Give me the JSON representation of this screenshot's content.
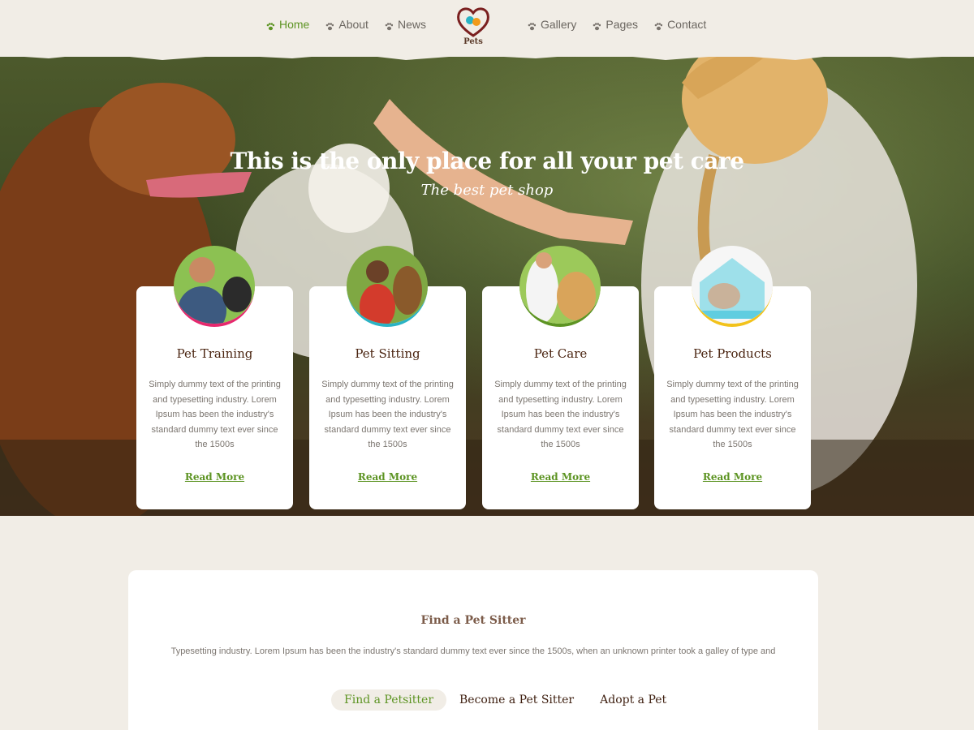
{
  "nav": {
    "left": [
      {
        "label": "Home",
        "active": true
      },
      {
        "label": "About",
        "active": false
      },
      {
        "label": "News",
        "active": false
      }
    ],
    "logo_text": "Pets",
    "right": [
      {
        "label": "Gallery"
      },
      {
        "label": "Pages"
      },
      {
        "label": "Contact"
      }
    ]
  },
  "hero": {
    "title": "This is the only place for all your pet care",
    "subtitle": "The best pet shop"
  },
  "cards": [
    {
      "title": "Pet Training",
      "text": "Simply dummy text of the printing and typesetting industry. Lorem Ipsum has been the industry's standard dummy text ever since the 1500s",
      "link": "Read More",
      "accent": "#e6286e"
    },
    {
      "title": "Pet Sitting",
      "text": "Simply dummy text of the printing and typesetting industry. Lorem Ipsum has been the industry's standard dummy text ever since the 1500s",
      "link": "Read More",
      "accent": "#2ab3c5"
    },
    {
      "title": "Pet Care",
      "text": "Simply dummy text of the printing and typesetting industry. Lorem Ipsum has been the industry's standard dummy text ever since the 1500s",
      "link": "Read More",
      "accent": "#5d9423"
    },
    {
      "title": "Pet Products",
      "text": "Simply dummy text of the printing and typesetting industry. Lorem Ipsum has been the industry's standard dummy text ever since the 1500s",
      "link": "Read More",
      "accent": "#f2c21b"
    }
  ],
  "find": {
    "title": "Find a Pet Sitter",
    "text": "Typesetting industry. Lorem Ipsum has been the industry's standard dummy text ever since the 1500s, when an unknown printer took a galley of type and",
    "tabs": [
      {
        "label": "Find a Petsitter",
        "active": true
      },
      {
        "label": "Become a Pet Sitter",
        "active": false
      },
      {
        "label": "Adopt a Pet",
        "active": false
      }
    ]
  },
  "colors": {
    "accent_green": "#5d9423",
    "brown": "#4a2410",
    "background": "#f1ede6"
  }
}
